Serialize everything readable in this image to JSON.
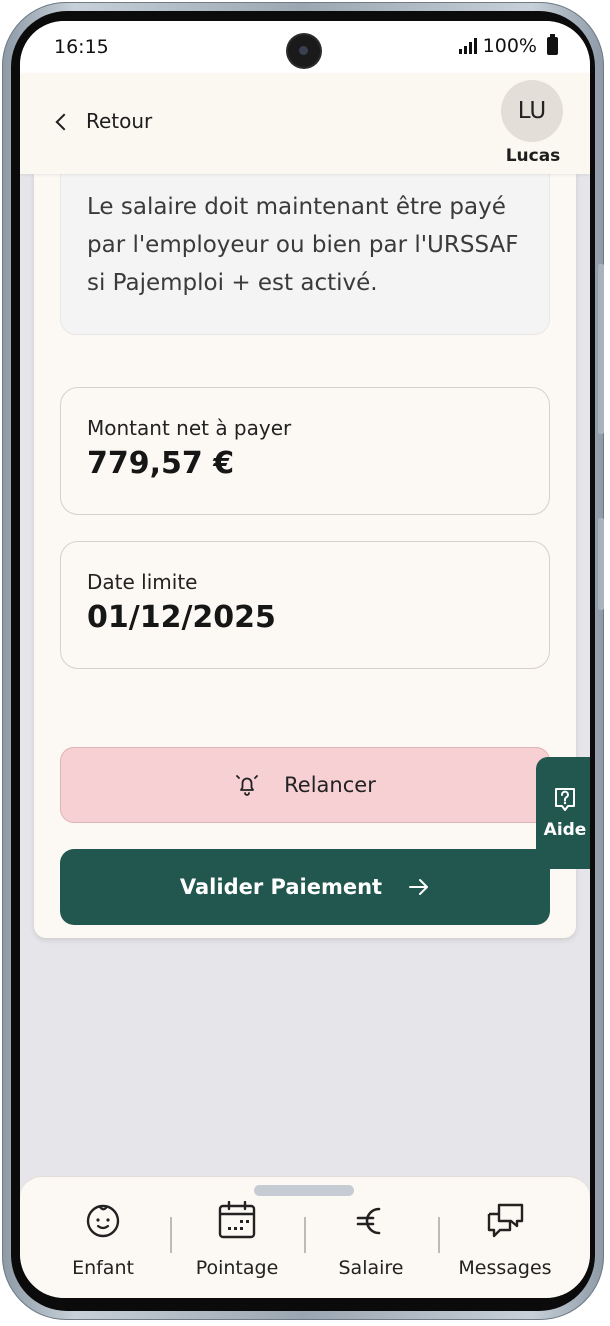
{
  "status_bar": {
    "time": "16:15",
    "battery": "100%"
  },
  "header": {
    "back_label": "Retour",
    "avatar_initials": "LU",
    "user_name": "Lucas"
  },
  "info_box": {
    "text": "Le salaire doit maintenant être payé par l'employeur ou bien par l'URSSAF si Pajemploi + est activé."
  },
  "amount": {
    "label": "Montant net à payer",
    "value": "779,57 €"
  },
  "deadline": {
    "label": "Date limite",
    "value": "01/12/2025"
  },
  "actions": {
    "remind_label": "Relancer",
    "validate_label": "Valider Paiement"
  },
  "help": {
    "label": "Aide"
  },
  "bottom_nav": {
    "items": [
      {
        "label": "Enfant",
        "icon": "baby-face-icon"
      },
      {
        "label": "Pointage",
        "icon": "calendar-icon"
      },
      {
        "label": "Salaire",
        "icon": "euro-icon"
      },
      {
        "label": "Messages",
        "icon": "chat-bubbles-icon"
      }
    ]
  },
  "colors": {
    "primary": "#21574f",
    "remind_bg": "#f7d0d3",
    "card_bg": "#fcf8f3",
    "screen_bg": "#e6e6ea"
  }
}
